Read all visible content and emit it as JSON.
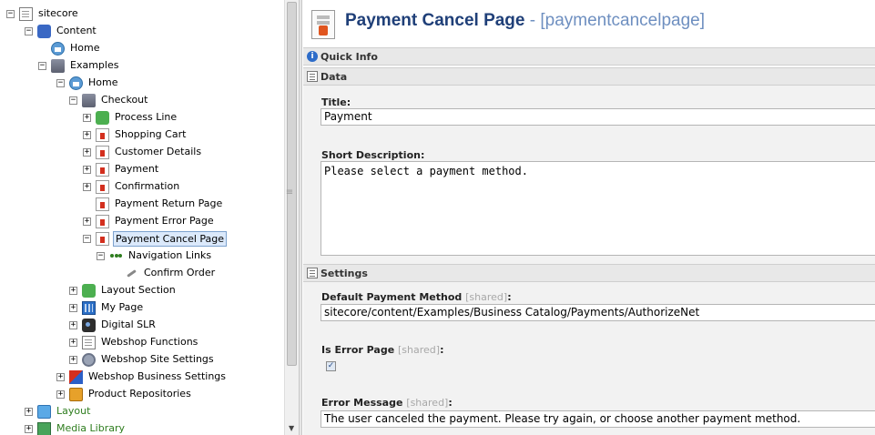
{
  "tree": {
    "items": [
      {
        "label": "sitecore",
        "icon": "document-icon",
        "expander": "−",
        "level": 0
      },
      {
        "label": "Content",
        "icon": "content-icon",
        "expander": "−",
        "level": 1
      },
      {
        "label": "Home",
        "icon": "home-icon",
        "expander": "",
        "level": 2
      },
      {
        "label": "Examples",
        "icon": "folder-icon",
        "expander": "−",
        "level": 2
      },
      {
        "label": "Home",
        "icon": "home-icon",
        "expander": "−",
        "level": 3
      },
      {
        "label": "Checkout",
        "icon": "folder-icon",
        "expander": "−",
        "level": 4
      },
      {
        "label": "Process Line",
        "icon": "process-icon",
        "expander": "+",
        "level": 5
      },
      {
        "label": "Shopping Cart",
        "icon": "page-icon",
        "expander": "+",
        "level": 5
      },
      {
        "label": "Customer Details",
        "icon": "page-icon",
        "expander": "+",
        "level": 5
      },
      {
        "label": "Payment",
        "icon": "page-icon",
        "expander": "+",
        "level": 5
      },
      {
        "label": "Confirmation",
        "icon": "page-icon",
        "expander": "+",
        "level": 5
      },
      {
        "label": "Payment Return Page",
        "icon": "page-icon",
        "expander": "",
        "level": 5
      },
      {
        "label": "Payment Error Page",
        "icon": "page-icon",
        "expander": "+",
        "level": 5
      },
      {
        "label": "Payment Cancel Page",
        "icon": "page-icon",
        "expander": "−",
        "level": 5,
        "selected": true
      },
      {
        "label": "Navigation Links",
        "icon": "navigation-links-icon",
        "expander": "−",
        "level": 6
      },
      {
        "label": "Confirm Order",
        "icon": "link-icon",
        "expander": "",
        "level": 7
      },
      {
        "label": "Layout Section",
        "icon": "layout-section-icon",
        "expander": "+",
        "level": 4
      },
      {
        "label": "My Page",
        "icon": "grid-icon",
        "expander": "+",
        "level": 4
      },
      {
        "label": "Digital SLR",
        "icon": "camera-icon",
        "expander": "+",
        "level": 4
      },
      {
        "label": "Webshop Functions",
        "icon": "functions-icon",
        "expander": "+",
        "level": 4
      },
      {
        "label": "Webshop Site Settings",
        "icon": "gear-icon",
        "expander": "+",
        "level": 4
      },
      {
        "label": "Webshop Business Settings",
        "icon": "business-settings-icon",
        "expander": "+",
        "level": 3
      },
      {
        "label": "Product Repositories",
        "icon": "box-icon",
        "expander": "+",
        "level": 3
      },
      {
        "label": "Layout",
        "icon": "layout-icon",
        "expander": "+",
        "level": 1,
        "green": true
      },
      {
        "label": "Media Library",
        "icon": "media-icon",
        "expander": "+",
        "level": 1,
        "green": true
      }
    ]
  },
  "editor": {
    "title": "Payment Cancel Page",
    "item_key": "- [paymentcancelpage]",
    "sections": {
      "quick_info": "Quick Info",
      "data": "Data",
      "settings": "Settings"
    },
    "fields": {
      "title_label": "Title:",
      "title_value": "Payment",
      "short_desc_label": "Short Description:",
      "short_desc_value": "Please select a payment method.",
      "default_payment_label": "Default Payment Method",
      "default_payment_value": "sitecore/content/Examples/Business Catalog/Payments/AuthorizeNet",
      "is_error_label": "Is Error Page",
      "is_error_checked": true,
      "error_message_label": "Error Message",
      "error_message_value": "The user canceled the payment. Please try again, or choose another payment method.",
      "shared_tag": "[shared]",
      "colon": ":"
    }
  }
}
